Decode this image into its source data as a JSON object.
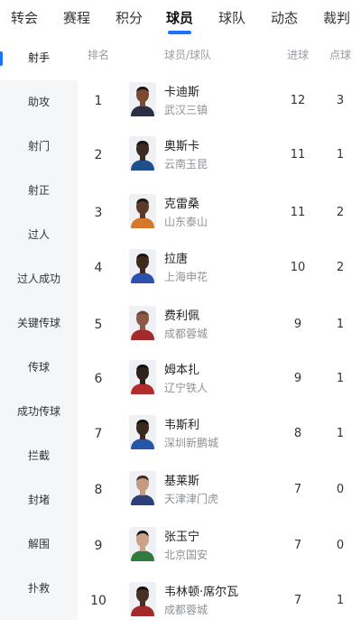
{
  "nav": {
    "tabs": [
      "转会",
      "赛程",
      "积分",
      "球员",
      "球队",
      "动态",
      "裁判"
    ],
    "active": "球员"
  },
  "sidebar": {
    "items": [
      "射手",
      "助攻",
      "射门",
      "射正",
      "过人",
      "过人成功",
      "关键传球",
      "传球",
      "成功传球",
      "拦截",
      "封堵",
      "解围",
      "扑救"
    ],
    "active": "射手"
  },
  "table": {
    "headers": {
      "rank": "排名",
      "player_team": "球员/球队",
      "goals": "进球",
      "penalties": "点球"
    },
    "rows": [
      {
        "rank": "1",
        "name": "卡迪斯",
        "team": "武汉三镇",
        "goals": "12",
        "penalties": "3",
        "skin": "#7a4a33",
        "jersey": "#2a2f45"
      },
      {
        "rank": "2",
        "name": "奥斯卡",
        "team": "云南玉昆",
        "goals": "11",
        "penalties": "1",
        "skin": "#3a2a22",
        "jersey": "#1f4f8a"
      },
      {
        "rank": "3",
        "name": "克雷桑",
        "team": "山东泰山",
        "goals": "11",
        "penalties": "2",
        "skin": "#5a3a28",
        "jersey": "#d4782c"
      },
      {
        "rank": "4",
        "name": "拉唐",
        "team": "上海申花",
        "goals": "10",
        "penalties": "2",
        "skin": "#3f2a1f",
        "jersey": "#2d4fae"
      },
      {
        "rank": "5",
        "name": "费利佩",
        "team": "成都蓉城",
        "goals": "9",
        "penalties": "1",
        "skin": "#8a5a45",
        "jersey": "#a22a2a"
      },
      {
        "rank": "6",
        "name": "姆本扎",
        "team": "辽宁铁人",
        "goals": "9",
        "penalties": "1",
        "skin": "#2f211b",
        "jersey": "#b32c2c"
      },
      {
        "rank": "7",
        "name": "韦斯利",
        "team": "深圳新鹏城",
        "goals": "8",
        "penalties": "1",
        "skin": "#3a271e",
        "jersey": "#2756a8"
      },
      {
        "rank": "8",
        "name": "基莱斯",
        "team": "天津津门虎",
        "goals": "7",
        "penalties": "0",
        "skin": "#c49a80",
        "jersey": "#2c3f78"
      },
      {
        "rank": "9",
        "name": "张玉宁",
        "team": "北京国安",
        "goals": "7",
        "penalties": "0",
        "skin": "#caa285",
        "jersey": "#2f7a3f"
      },
      {
        "rank": "10",
        "name": "韦林顿·席尔瓦",
        "team": "成都蓉城",
        "goals": "7",
        "penalties": "1",
        "skin": "#4a3024",
        "jersey": "#a22a2a"
      }
    ]
  },
  "colors": {
    "accent": "#1a73ff",
    "sidebar_bg": "#f5f6f8",
    "muted_text": "#8e9196"
  }
}
